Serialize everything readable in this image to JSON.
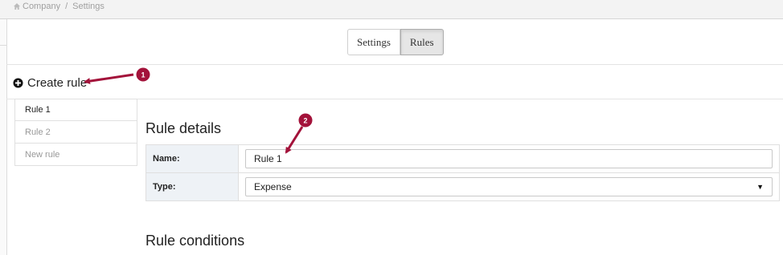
{
  "breadcrumb": {
    "items": [
      "Company",
      "Settings"
    ],
    "separator": "/"
  },
  "tabs": [
    {
      "label": "Settings",
      "active": false
    },
    {
      "label": "Rules",
      "active": true
    }
  ],
  "create_rule": {
    "label": "Create rule"
  },
  "rules": [
    {
      "label": "Rule 1",
      "active": true
    },
    {
      "label": "Rule 2",
      "active": false
    },
    {
      "label": "New rule",
      "active": false
    }
  ],
  "rule_details": {
    "title": "Rule details",
    "name_label": "Name:",
    "name_value": "Rule 1",
    "type_label": "Type:",
    "type_value": "Expense"
  },
  "rule_conditions": {
    "title": "Rule conditions"
  },
  "annotations": [
    {
      "number": "1"
    },
    {
      "number": "2"
    }
  ],
  "colors": {
    "annotation": "#a3123a",
    "label_bg": "#eef2f6",
    "active_tab_bg": "#e6e6e6"
  }
}
